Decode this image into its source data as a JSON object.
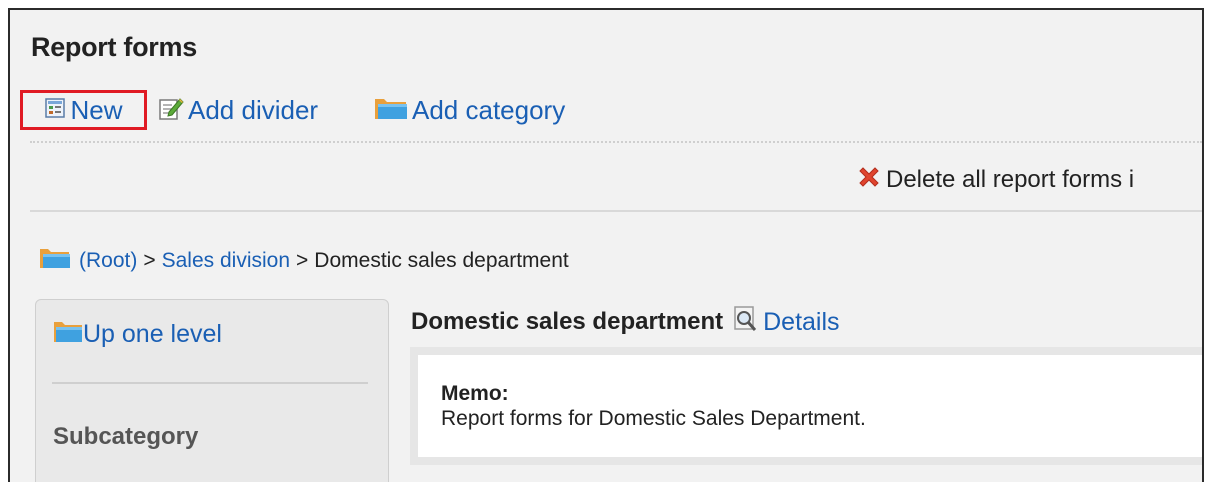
{
  "page": {
    "title": "Report forms"
  },
  "toolbar": {
    "new_label": "New",
    "add_divider_label": "Add divider",
    "add_category_label": "Add category",
    "new_icon": "form-new-icon",
    "add_divider_icon": "edit-pencil-icon",
    "add_category_icon": "folder-icon"
  },
  "actions": {
    "delete_all_label": "Delete all report forms i",
    "delete_icon": "red-x-icon"
  },
  "breadcrumb": {
    "root": "(Root)",
    "sep1": ">",
    "level1": "Sales division",
    "sep2": ">",
    "current": "Domestic sales department"
  },
  "sidebar": {
    "up_one_level": "Up one level",
    "subcategory_title": "Subcategory"
  },
  "category": {
    "name": "Domestic sales department",
    "details_label": "Details",
    "memo_label": "Memo:",
    "memo_text": "Report forms for Domestic Sales Department."
  },
  "colors": {
    "link": "#1a5fb4",
    "highlight": "#e01b24",
    "panel_bg": "#f2f2f2"
  }
}
